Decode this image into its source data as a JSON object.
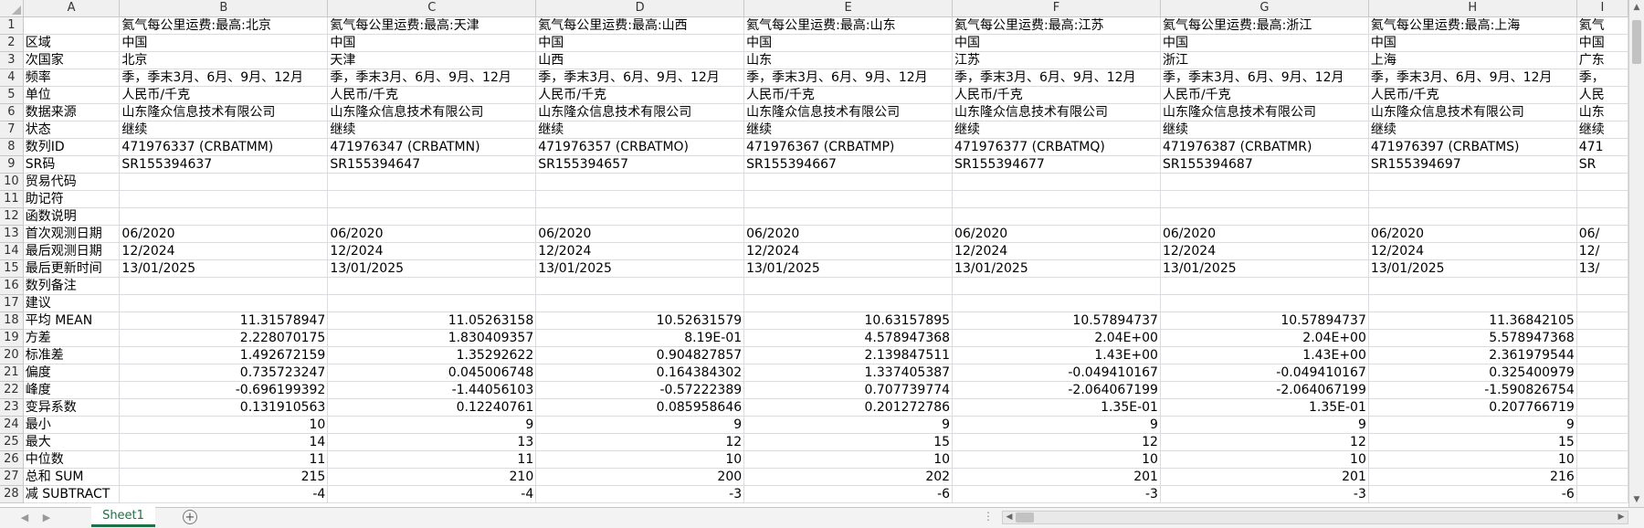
{
  "columns": [
    "A",
    "B",
    "C",
    "D",
    "E",
    "F",
    "G",
    "H",
    "I"
  ],
  "rows": [
    [
      "",
      "氦气每公里运费:最高:北京",
      "氦气每公里运费:最高:天津",
      "氦气每公里运费:最高:山西",
      "氦气每公里运费:最高:山东",
      "氦气每公里运费:最高:江苏",
      "氦气每公里运费:最高:浙江",
      "氦气每公里运费:最高:上海",
      "氦气"
    ],
    [
      "区域",
      "中国",
      "中国",
      "中国",
      "中国",
      "中国",
      "中国",
      "中国",
      "中国"
    ],
    [
      "次国家",
      "北京",
      "天津",
      "山西",
      "山东",
      "江苏",
      "浙江",
      "上海",
      "广东"
    ],
    [
      "频率",
      "季，季末3月、6月、9月、12月",
      "季，季末3月、6月、9月、12月",
      "季，季末3月、6月、9月、12月",
      "季，季末3月、6月、9月、12月",
      "季，季末3月、6月、9月、12月",
      "季，季末3月、6月、9月、12月",
      "季，季末3月、6月、9月、12月",
      "季，"
    ],
    [
      "单位",
      "人民币/千克",
      "人民币/千克",
      "人民币/千克",
      "人民币/千克",
      "人民币/千克",
      "人民币/千克",
      "人民币/千克",
      "人民"
    ],
    [
      "数据来源",
      "山东隆众信息技术有限公司",
      "山东隆众信息技术有限公司",
      "山东隆众信息技术有限公司",
      "山东隆众信息技术有限公司",
      "山东隆众信息技术有限公司",
      "山东隆众信息技术有限公司",
      "山东隆众信息技术有限公司",
      "山东"
    ],
    [
      "状态",
      "继续",
      "继续",
      "继续",
      "继续",
      "继续",
      "继续",
      "继续",
      "继续"
    ],
    [
      "数列ID",
      "471976337 (CRBATMM)",
      "471976347 (CRBATMN)",
      "471976357 (CRBATMO)",
      "471976367 (CRBATMP)",
      "471976377 (CRBATMQ)",
      "471976387 (CRBATMR)",
      "471976397 (CRBATMS)",
      "471"
    ],
    [
      "SR码",
      "SR155394637",
      "SR155394647",
      "SR155394657",
      "SR155394667",
      "SR155394677",
      "SR155394687",
      "SR155394697",
      "SR"
    ],
    [
      "贸易代码",
      "",
      "",
      "",
      "",
      "",
      "",
      "",
      ""
    ],
    [
      "助记符",
      "",
      "",
      "",
      "",
      "",
      "",
      "",
      ""
    ],
    [
      "函数说明",
      "",
      "",
      "",
      "",
      "",
      "",
      "",
      ""
    ],
    [
      "首次观测日期",
      "06/2020",
      "06/2020",
      "06/2020",
      "06/2020",
      "06/2020",
      "06/2020",
      "06/2020",
      "06/"
    ],
    [
      "最后观测日期",
      "12/2024",
      "12/2024",
      "12/2024",
      "12/2024",
      "12/2024",
      "12/2024",
      "12/2024",
      "12/"
    ],
    [
      "最后更新时间",
      "13/01/2025",
      "13/01/2025",
      "13/01/2025",
      "13/01/2025",
      "13/01/2025",
      "13/01/2025",
      "13/01/2025",
      "13/"
    ],
    [
      "数列备注",
      "",
      "",
      "",
      "",
      "",
      "",
      "",
      ""
    ],
    [
      "建议",
      "",
      "",
      "",
      "",
      "",
      "",
      "",
      ""
    ],
    [
      "平均 MEAN",
      "11.31578947",
      "11.05263158",
      "10.52631579",
      "10.63157895",
      "10.57894737",
      "10.57894737",
      "11.36842105",
      ""
    ],
    [
      "方差",
      "2.228070175",
      "1.830409357",
      "8.19E-01",
      "4.578947368",
      "2.04E+00",
      "2.04E+00",
      "5.578947368",
      ""
    ],
    [
      "标准差",
      "1.492672159",
      "1.35292622",
      "0.904827857",
      "2.139847511",
      "1.43E+00",
      "1.43E+00",
      "2.361979544",
      ""
    ],
    [
      "偏度",
      "0.735723247",
      "0.045006748",
      "0.164384302",
      "1.337405387",
      "-0.049410167",
      "-0.049410167",
      "0.325400979",
      ""
    ],
    [
      "峰度",
      "-0.696199392",
      "-1.44056103",
      "-0.57222389",
      "0.707739774",
      "-2.064067199",
      "-2.064067199",
      "-1.590826754",
      ""
    ],
    [
      "变异系数",
      "0.131910563",
      "0.12240761",
      "0.085958646",
      "0.201272786",
      "1.35E-01",
      "1.35E-01",
      "0.207766719",
      ""
    ],
    [
      "最小",
      "10",
      "9",
      "9",
      "9",
      "9",
      "9",
      "9",
      ""
    ],
    [
      "最大",
      "14",
      "13",
      "12",
      "15",
      "12",
      "12",
      "15",
      ""
    ],
    [
      "中位数",
      "11",
      "11",
      "10",
      "10",
      "10",
      "10",
      "10",
      ""
    ],
    [
      "总和 SUM",
      "215",
      "210",
      "200",
      "202",
      "201",
      "201",
      "216",
      ""
    ],
    [
      "减 SUBTRACT",
      "-4",
      "-4",
      "-3",
      "-6",
      "-3",
      "-3",
      "-6",
      ""
    ]
  ],
  "numeric_start_row": 18,
  "bottom": {
    "sheet_tab_label": "Sheet1",
    "add_sheet_label": "+",
    "split_dots": "⋮",
    "nav_prev": "◀",
    "nav_next": "▶"
  },
  "colors": {
    "accent": "#1e7145",
    "header_bg": "#f0f0f0",
    "grid": "#dadcdf"
  }
}
